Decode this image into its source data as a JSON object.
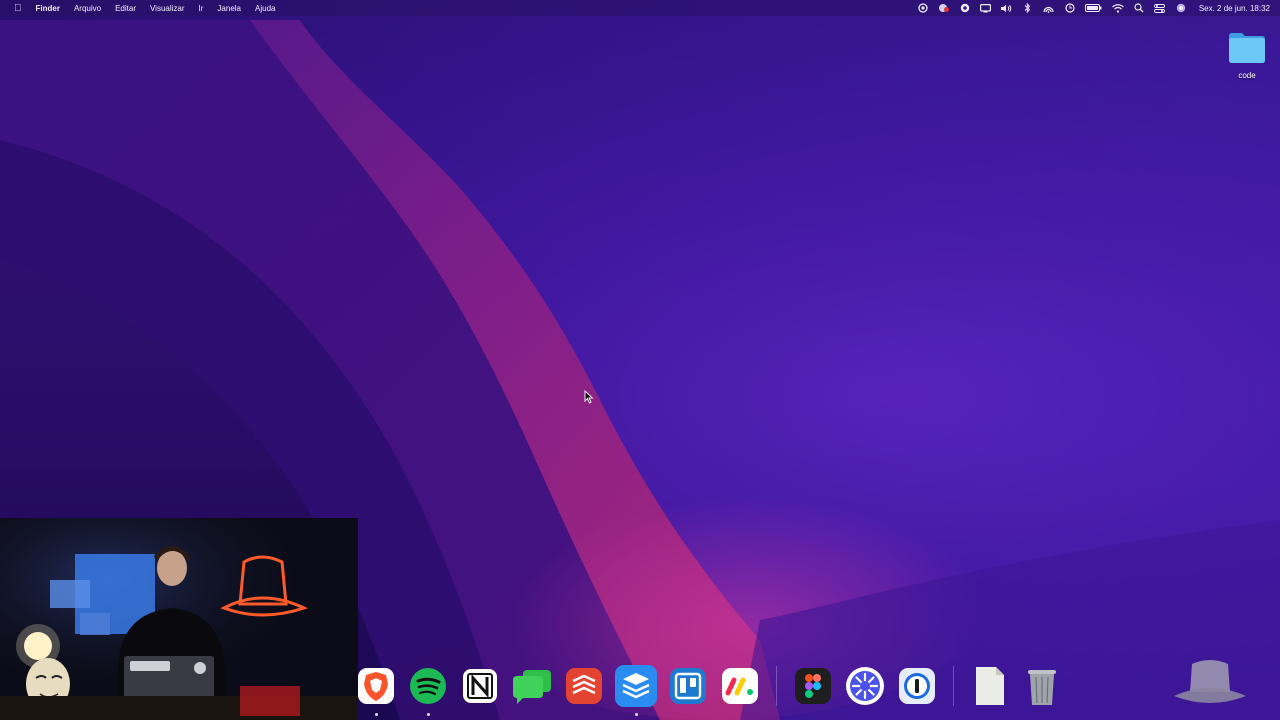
{
  "menubar": {
    "apple_icon": "apple-icon",
    "items": [
      {
        "label": "Finder",
        "bold": true
      },
      {
        "label": "Arquivo"
      },
      {
        "label": "Editar"
      },
      {
        "label": "Visualizar"
      },
      {
        "label": "Ir"
      },
      {
        "label": "Janela"
      },
      {
        "label": "Ajuda"
      }
    ],
    "status_icons": [
      "camera-control-icon",
      "record-icon",
      "screen-record-icon",
      "display-icon",
      "volume-icon",
      "bluetooth-icon",
      "airdrop-icon",
      "timer-icon",
      "battery-icon",
      "wifi-icon",
      "search-icon",
      "control-center-icon",
      "siri-icon"
    ],
    "clock": "Sex. 2 de jun.  18:32"
  },
  "desktop": {
    "folder_label": "code"
  },
  "dock": {
    "apps": [
      "brave-icon",
      "spotify-icon",
      "notion-icon",
      "messages-icon",
      "todoist-icon",
      "buffer-icon",
      "trello-icon",
      "monday-icon",
      "figma-icon",
      "perplexity-icon",
      "1password-icon"
    ],
    "docs": [
      "document-icon",
      "trash-icon"
    ]
  },
  "colors": {
    "wallpaper_deep": "#1e0b5c",
    "wallpaper_mid": "#3c1497",
    "wallpaper_pink": "#b0247a",
    "folder_blue": "#5ab8f0",
    "menubar_text": "#f2ecff"
  }
}
